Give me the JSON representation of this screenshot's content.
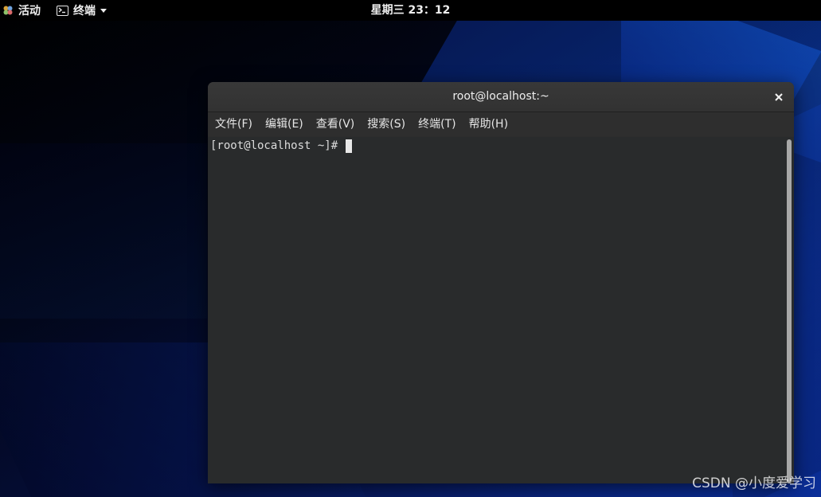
{
  "topbar": {
    "activities_label": "活动",
    "app_menu_label": "终端",
    "clock": "星期三 23：12"
  },
  "window": {
    "title": "root@localhost:~",
    "close_symbol": "×",
    "menu": [
      {
        "label": "文件(F)"
      },
      {
        "label": "编辑(E)"
      },
      {
        "label": "查看(V)"
      },
      {
        "label": "搜索(S)"
      },
      {
        "label": "终端(T)"
      },
      {
        "label": "帮助(H)"
      }
    ],
    "terminal": {
      "prompt": "[root@localhost ~]#"
    }
  },
  "watermark": "CSDN @小度爱学习",
  "colors": {
    "topbar_bg": "#000000",
    "window_titlebar": "#353535",
    "terminal_bg": "#292b2c",
    "desktop_accent": "#0c3bb0"
  },
  "icons": {
    "activities": "activities-icon",
    "app_menu": "terminal-icon",
    "app_menu_arrow": "caret-down-icon",
    "close": "close-icon"
  }
}
